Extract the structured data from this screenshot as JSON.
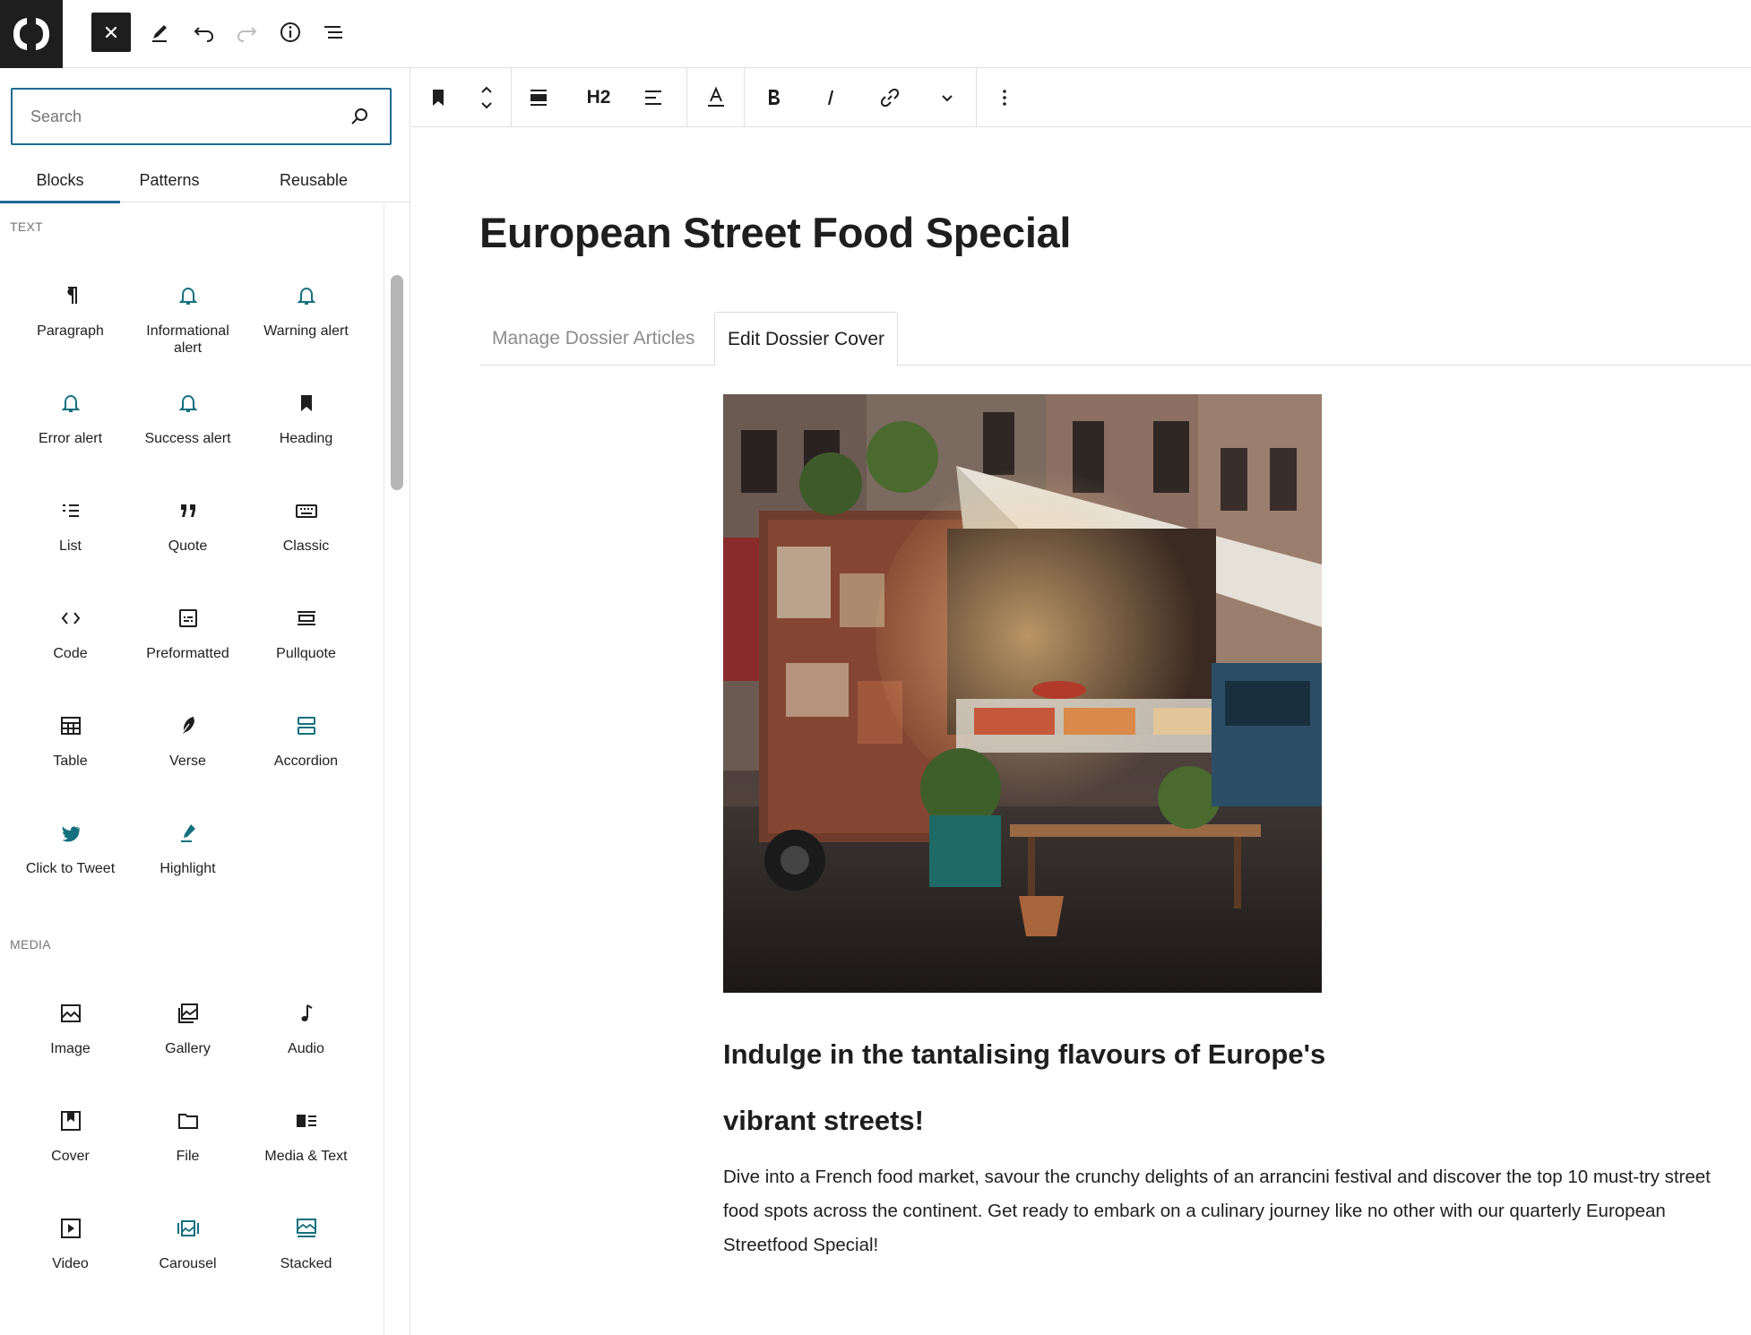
{
  "topbar": {
    "logo_icon": "brand-logo-icon",
    "buttons": [
      "close-icon",
      "pencil-icon",
      "undo-icon",
      "redo-icon",
      "info-icon",
      "list-view-icon"
    ]
  },
  "sidebar": {
    "search": {
      "placeholder": "Search",
      "value": ""
    },
    "tabs": [
      {
        "label": "Blocks",
        "active": true
      },
      {
        "label": "Patterns",
        "active": false
      },
      {
        "label": "Reusable",
        "active": false
      }
    ],
    "categories": [
      {
        "label": "TEXT",
        "items": [
          {
            "label": "Paragraph",
            "icon": "paragraph-icon"
          },
          {
            "label": "Informational alert",
            "icon": "bell-icon"
          },
          {
            "label": "Warning alert",
            "icon": "bell-icon"
          },
          {
            "label": "Error alert",
            "icon": "bell-icon"
          },
          {
            "label": "Success alert",
            "icon": "bell-icon"
          },
          {
            "label": "Heading",
            "icon": "bookmark-icon"
          },
          {
            "label": "List",
            "icon": "list-icon"
          },
          {
            "label": "Quote",
            "icon": "quote-icon"
          },
          {
            "label": "Classic",
            "icon": "keyboard-icon"
          },
          {
            "label": "Code",
            "icon": "code-icon"
          },
          {
            "label": "Preformatted",
            "icon": "preformatted-icon"
          },
          {
            "label": "Pullquote",
            "icon": "pullquote-icon"
          },
          {
            "label": "Table",
            "icon": "table-icon"
          },
          {
            "label": "Verse",
            "icon": "feather-icon"
          },
          {
            "label": "Accordion",
            "icon": "accordion-icon"
          },
          {
            "label": "Click to Tweet",
            "icon": "twitter-icon"
          },
          {
            "label": "Highlight",
            "icon": "highlighter-icon"
          }
        ]
      },
      {
        "label": "MEDIA",
        "items": [
          {
            "label": "Image",
            "icon": "image-icon"
          },
          {
            "label": "Gallery",
            "icon": "gallery-icon"
          },
          {
            "label": "Audio",
            "icon": "music-note-icon"
          },
          {
            "label": "Cover",
            "icon": "cover-icon"
          },
          {
            "label": "File",
            "icon": "folder-icon"
          },
          {
            "label": "Media & Text",
            "icon": "media-text-icon"
          },
          {
            "label": "Video",
            "icon": "video-icon"
          },
          {
            "label": "Carousel",
            "icon": "carousel-icon"
          },
          {
            "label": "Stacked",
            "icon": "stacked-icon"
          }
        ]
      }
    ]
  },
  "block_toolbar": {
    "heading_level": "H2",
    "buttons": [
      "bookmark-icon",
      "move-up-down-icon",
      "align-wide-icon",
      "heading-level",
      "align-left-icon",
      "text-color-icon",
      "bold-icon",
      "italic-icon",
      "link-icon",
      "chevron-down-icon",
      "more-options-icon"
    ]
  },
  "canvas": {
    "title": "European Street Food Special",
    "dossier_tabs": [
      {
        "label": "Manage Dossier Articles",
        "active": false
      },
      {
        "label": "Edit Dossier Cover",
        "active": true
      }
    ],
    "cover": {
      "heading": "Indulge in the tantalising flavours of Europe's vibrant streets!",
      "paragraph": "Dive into a French food market, savour the crunchy delights of an arrancini festival and discover the top 10 must-try street food spots across the continent. Get ready to embark on a culinary journey like no other with our quarterly European Streetfood Special!"
    }
  },
  "colors": {
    "accent": "#1d6a92",
    "teal_icon": "#14707e",
    "dark": "#1e1e1e",
    "muted": "#757575"
  }
}
